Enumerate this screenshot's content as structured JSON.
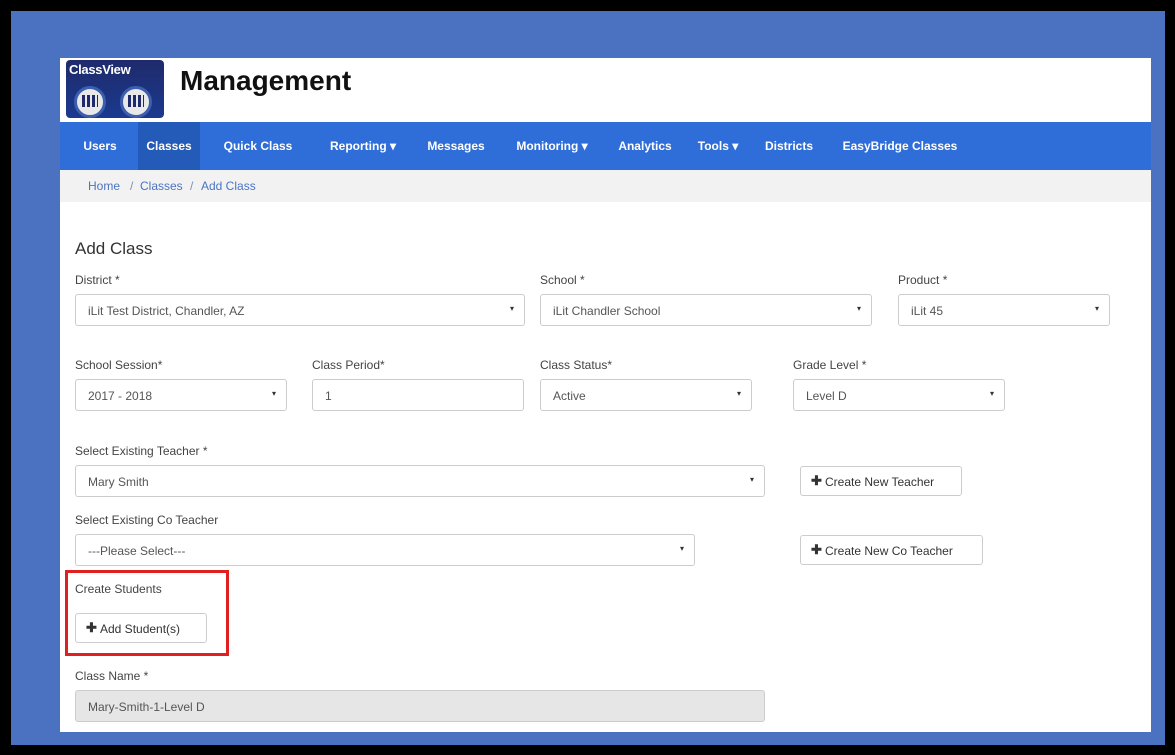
{
  "header": {
    "logo_text": "ClassView",
    "title": "Management"
  },
  "nav": {
    "items": [
      {
        "label": "Users"
      },
      {
        "label": "Classes"
      },
      {
        "label": "Quick Class"
      },
      {
        "label": "Reporting ▾"
      },
      {
        "label": "Messages"
      },
      {
        "label": "Monitoring ▾"
      },
      {
        "label": "Analytics"
      },
      {
        "label": "Tools ▾"
      },
      {
        "label": "Districts"
      },
      {
        "label": "EasyBridge Classes"
      }
    ],
    "active_index": 1
  },
  "breadcrumb": {
    "home": "Home",
    "classes": "Classes",
    "current": "Add Class",
    "separator": "/"
  },
  "form": {
    "heading": "Add Class",
    "district": {
      "label": "District *",
      "value": "iLit Test District, Chandler, AZ"
    },
    "school": {
      "label": "School *",
      "value": "iLit Chandler School"
    },
    "product": {
      "label": "Product *",
      "value": "iLit 45"
    },
    "school_session": {
      "label": "School Session*",
      "value": "2017 - 2018"
    },
    "class_period": {
      "label": "Class Period*",
      "value": "1"
    },
    "class_status": {
      "label": "Class Status*",
      "value": "Active"
    },
    "grade_level": {
      "label": "Grade Level *",
      "value": "Level D"
    },
    "teacher": {
      "label": "Select Existing Teacher *",
      "value": "Mary Smith"
    },
    "create_teacher_button": "Create New Teacher",
    "co_teacher": {
      "label": "Select Existing Co Teacher",
      "value": "---Please Select---"
    },
    "create_co_teacher_button": "Create New Co Teacher",
    "create_students_label": "Create Students",
    "add_students_button": "Add Student(s)",
    "class_name": {
      "label": "Class Name *",
      "value": "Mary-Smith-1-Level D"
    }
  },
  "icons": {
    "caret": "▾",
    "plus": "✚"
  },
  "colors": {
    "navbar": "#2f6ed8",
    "frame": "#4a72c0",
    "highlight": "#e02020"
  }
}
